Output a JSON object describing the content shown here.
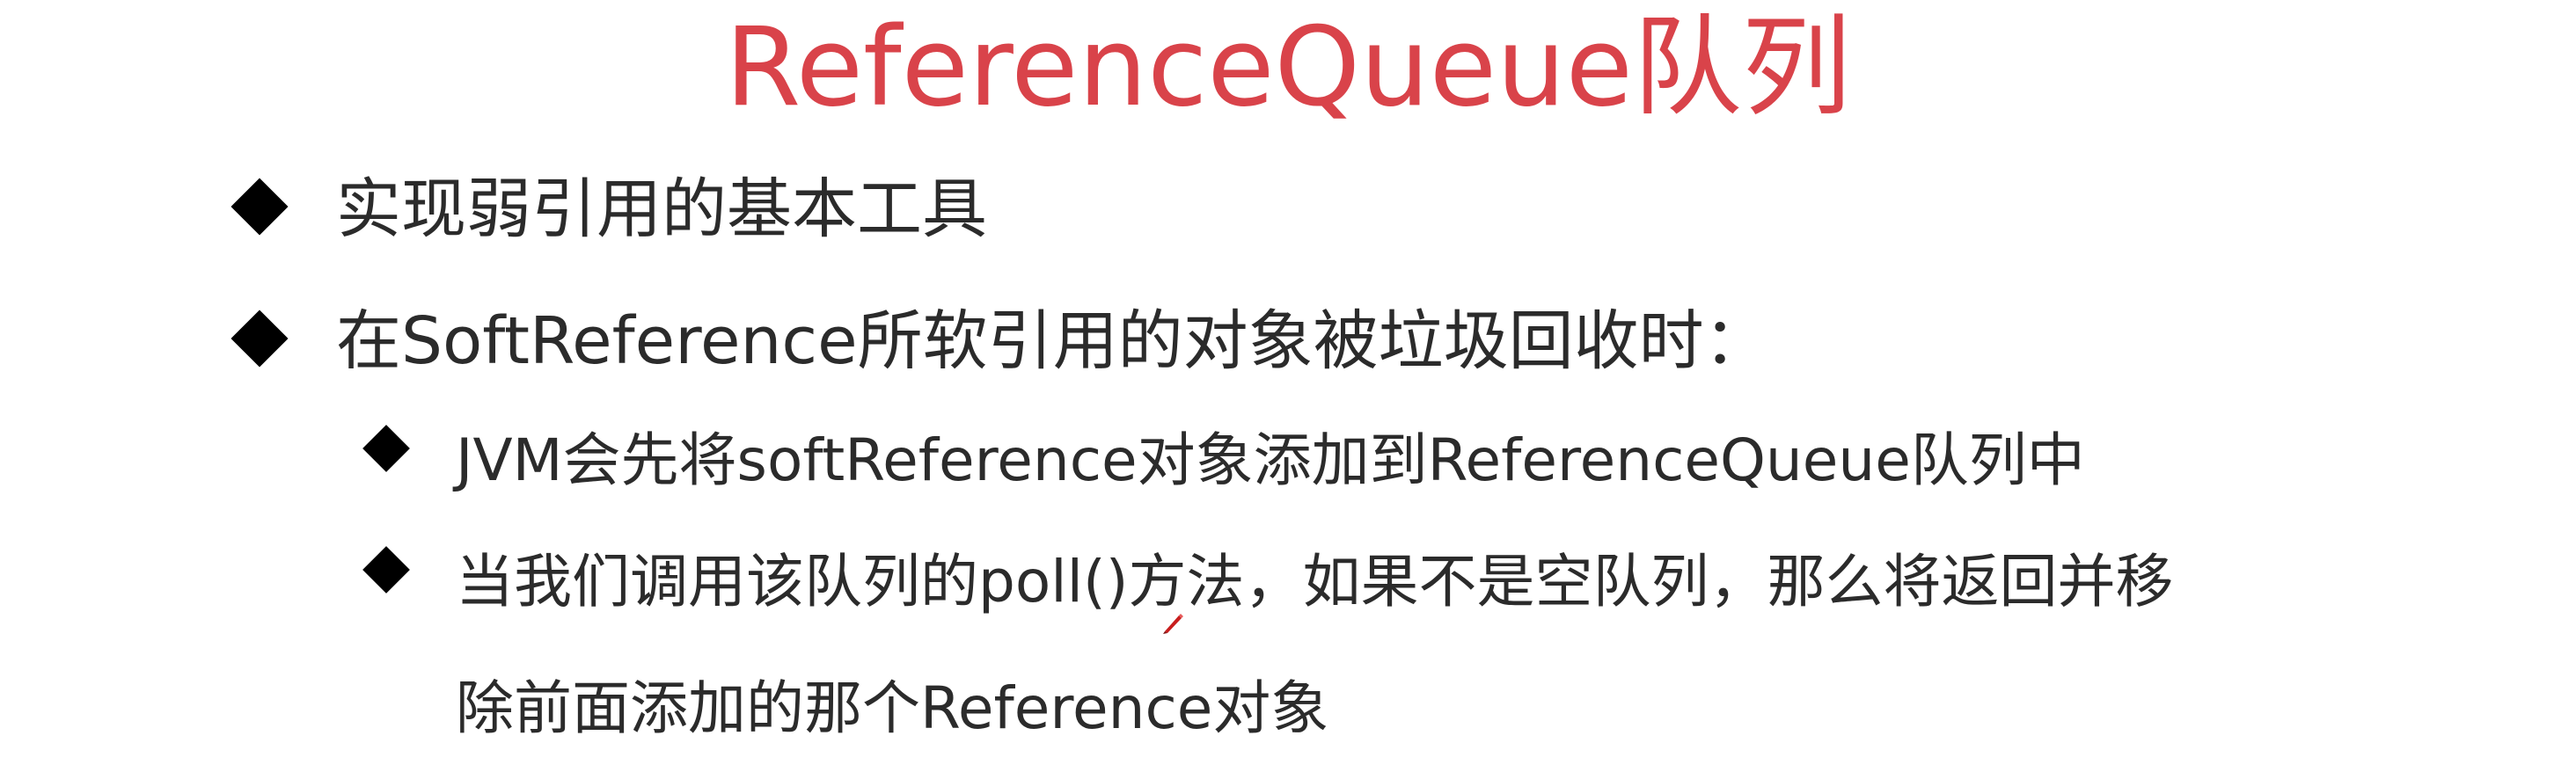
{
  "slide": {
    "title": "ReferenceQueue队列",
    "bullets": [
      {
        "text": "实现弱引用的基本工具"
      },
      {
        "text": "在SoftReference所软引用的对象被垃圾回收时："
      }
    ],
    "sub_bullets": [
      {
        "text": "JVM会先将softReference对象添加到ReferenceQueue队列中"
      },
      {
        "line1": "当我们调用该队列的poll()方法，如果不是空队列，那么将返回并移",
        "line2": "除前面添加的那个Reference对象"
      }
    ]
  },
  "colors": {
    "title": "#d9434a",
    "body_text": "#2b2b2b",
    "bullet": "#000000",
    "cursor": "#c81e1e"
  }
}
